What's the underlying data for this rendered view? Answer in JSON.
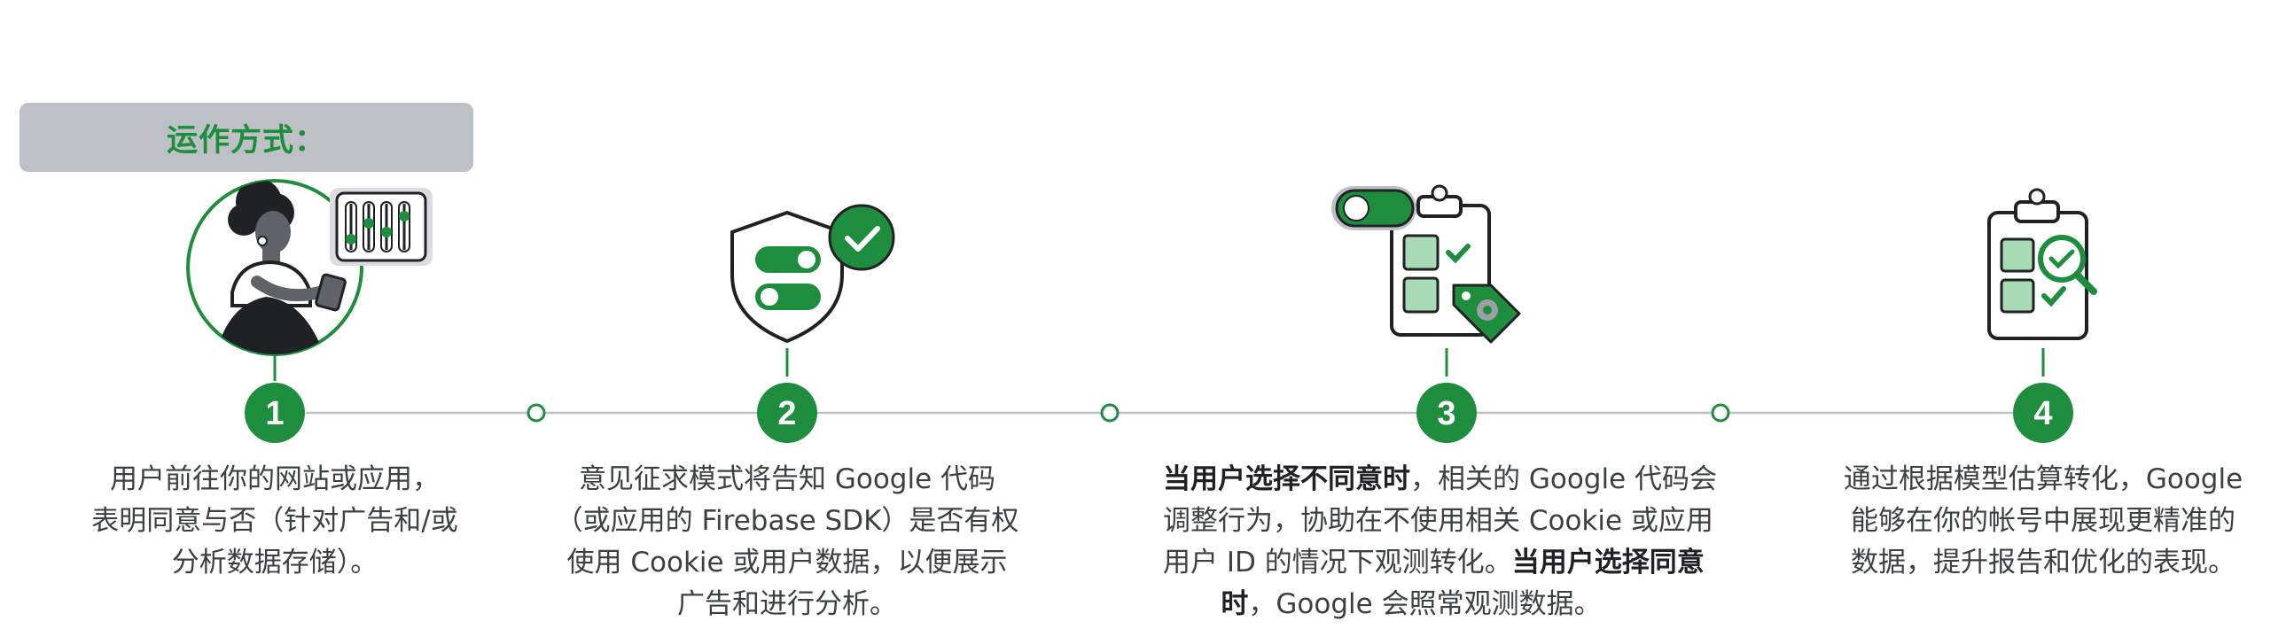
{
  "header": {
    "label": "运作方式："
  },
  "colors": {
    "green": "#1e8e3e",
    "light_green": "#a8dab5",
    "gray_line": "#bdc1c6",
    "tag_bg": "#bdc1c6",
    "text": "#3c4043"
  },
  "steps": [
    {
      "number": "1",
      "icon": "person-with-settings-icon",
      "lines": [
        {
          "parts": [
            {
              "text": "用户前往你的网站或应用，"
            }
          ]
        },
        {
          "parts": [
            {
              "text": "表明同意与否（针对广告和/或"
            }
          ]
        },
        {
          "parts": [
            {
              "text": "分析数据存储）。"
            }
          ]
        }
      ]
    },
    {
      "number": "2",
      "icon": "shield-toggles-icon",
      "lines": [
        {
          "parts": [
            {
              "text": "意见征求模式将告知 Google 代码"
            }
          ]
        },
        {
          "parts": [
            {
              "text": "（或应用的 Firebase SDK）是否有权"
            }
          ]
        },
        {
          "parts": [
            {
              "text": "使用 Cookie 或用户数据，以便展示"
            }
          ]
        },
        {
          "parts": [
            {
              "text": "广告和进行分析。"
            }
          ]
        }
      ]
    },
    {
      "number": "3",
      "icon": "clipboard-toggle-tag-icon",
      "lines": [
        {
          "parts": [
            {
              "text": "当用户选择不同意时",
              "bold": true
            },
            {
              "text": "，相关的 Google 代码会"
            }
          ]
        },
        {
          "parts": [
            {
              "text": "调整行为，协助在不使用相关 Cookie 或应用"
            }
          ]
        },
        {
          "parts": [
            {
              "text": "用户 ID 的情况下观测转化。"
            },
            {
              "text": "当用户选择同意",
              "bold": true
            }
          ]
        },
        {
          "parts": [
            {
              "text": "时",
              "bold": true
            },
            {
              "text": "，Google 会照常观测数据。"
            }
          ]
        }
      ]
    },
    {
      "number": "4",
      "icon": "clipboard-magnifier-icon",
      "lines": [
        {
          "parts": [
            {
              "text": "通过根据模型估算转化，Google"
            }
          ]
        },
        {
          "parts": [
            {
              "text": "能够在你的帐号中展现更精准的"
            }
          ]
        },
        {
          "parts": [
            {
              "text": "数据，提升报告和优化的表现。"
            }
          ]
        }
      ]
    }
  ]
}
